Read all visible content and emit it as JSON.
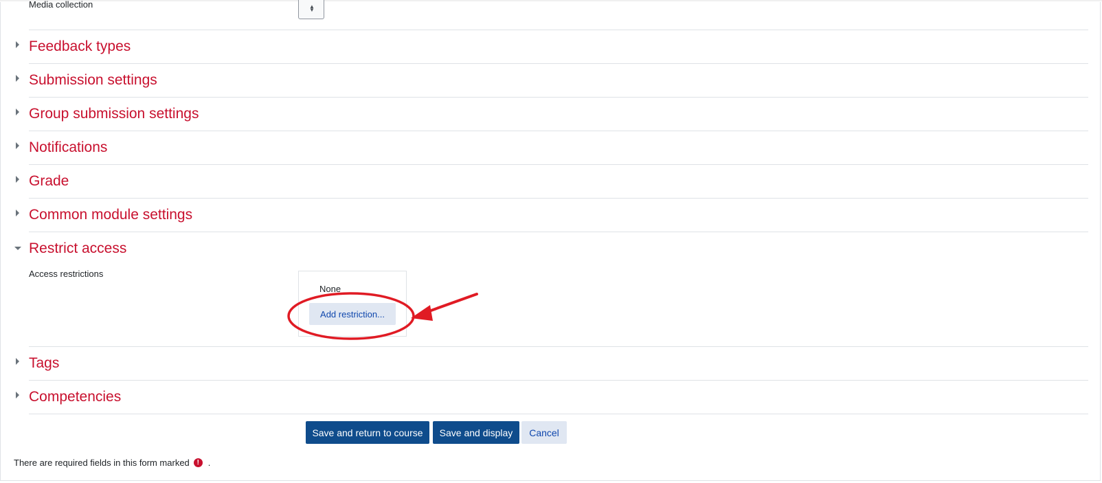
{
  "top_row": {
    "label": "Media collection"
  },
  "sections": [
    {
      "title": "Feedback types",
      "expanded": false
    },
    {
      "title": "Submission settings",
      "expanded": false
    },
    {
      "title": "Group submission settings",
      "expanded": false
    },
    {
      "title": "Notifications",
      "expanded": false
    },
    {
      "title": "Grade",
      "expanded": false
    },
    {
      "title": "Common module settings",
      "expanded": false
    },
    {
      "title": "Restrict access",
      "expanded": true
    },
    {
      "title": "Tags",
      "expanded": false
    },
    {
      "title": "Competencies",
      "expanded": false
    }
  ],
  "restrict_access": {
    "field_label": "Access restrictions",
    "current_value": "None",
    "add_button": "Add restriction..."
  },
  "actions": {
    "save_return": "Save and return to course",
    "save_display": "Save and display",
    "cancel": "Cancel"
  },
  "required_note": {
    "text": "There are required fields in this form marked",
    "suffix": ".",
    "icon": "!"
  },
  "colors": {
    "section_title": "#c8102e",
    "primary_button": "#0f4c8c",
    "secondary_button": "#e0e7f2",
    "annotation": "#e01b24"
  },
  "icons": {
    "collapsed": "chevron-right-icon",
    "expanded": "chevron-down-icon",
    "required": "exclamation-circle-icon"
  }
}
